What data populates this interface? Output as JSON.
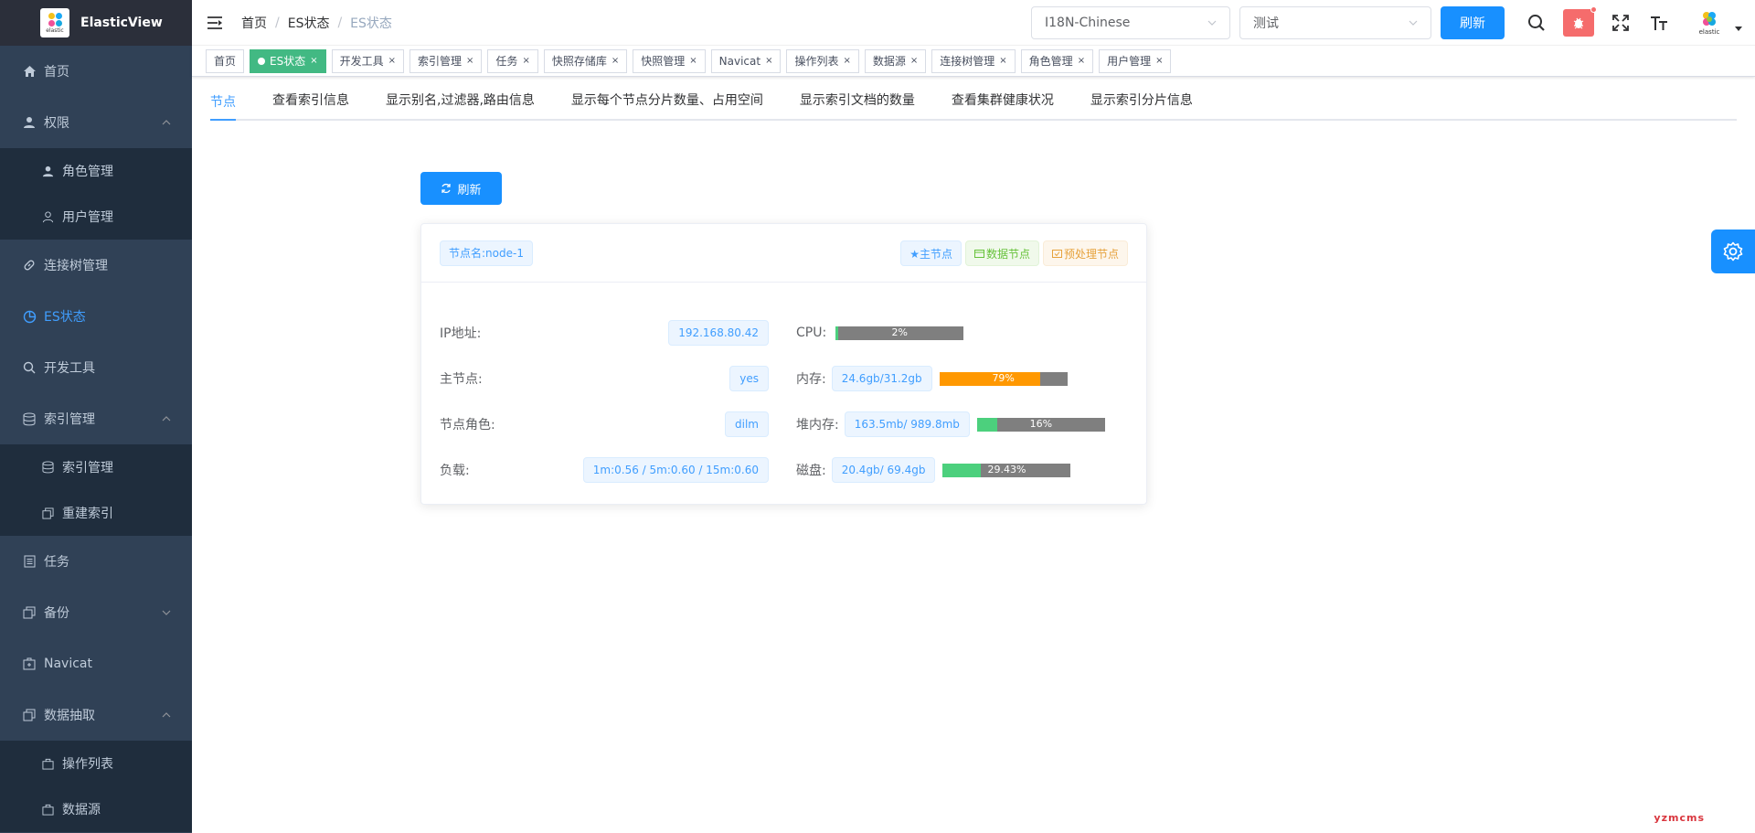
{
  "app": {
    "title": "ElasticView",
    "logo_text": "elastic"
  },
  "sidebar": {
    "items": [
      {
        "label": "首页",
        "icon": "home-icon"
      },
      {
        "label": "权限",
        "icon": "user-icon",
        "expanded": true,
        "children": [
          {
            "label": "角色管理",
            "icon": "user-icon"
          },
          {
            "label": "用户管理",
            "icon": "user-outline-icon"
          }
        ]
      },
      {
        "label": "连接树管理",
        "icon": "link-icon"
      },
      {
        "label": "ES状态",
        "icon": "pie-chart-icon",
        "active": true
      },
      {
        "label": "开发工具",
        "icon": "search-icon"
      },
      {
        "label": "索引管理",
        "icon": "database-icon",
        "expanded": true,
        "children": [
          {
            "label": "索引管理",
            "icon": "database-icon"
          },
          {
            "label": "重建索引",
            "icon": "copy-icon"
          }
        ]
      },
      {
        "label": "任务",
        "icon": "list-icon"
      },
      {
        "label": "备份",
        "icon": "copy-icon",
        "expanded": false
      },
      {
        "label": "Navicat",
        "icon": "navicat-icon"
      },
      {
        "label": "数据抽取",
        "icon": "copy-icon",
        "expanded": true,
        "children": [
          {
            "label": "操作列表",
            "icon": "bag-icon"
          },
          {
            "label": "数据源",
            "icon": "bag-icon"
          }
        ]
      }
    ]
  },
  "navbar": {
    "breadcrumb": [
      "首页",
      "ES状态",
      "ES状态"
    ],
    "language_select": "I18N-Chinese",
    "cluster_select": "测试",
    "refresh_label": "刷新"
  },
  "tags": [
    {
      "label": "首页",
      "closable": false,
      "active": false
    },
    {
      "label": "ES状态",
      "closable": true,
      "active": true
    },
    {
      "label": "开发工具",
      "closable": true
    },
    {
      "label": "索引管理",
      "closable": true
    },
    {
      "label": "任务",
      "closable": true
    },
    {
      "label": "快照存储库",
      "closable": true
    },
    {
      "label": "快照管理",
      "closable": true
    },
    {
      "label": "Navicat",
      "closable": true
    },
    {
      "label": "操作列表",
      "closable": true
    },
    {
      "label": "数据源",
      "closable": true
    },
    {
      "label": "连接树管理",
      "closable": true
    },
    {
      "label": "角色管理",
      "closable": true
    },
    {
      "label": "用户管理",
      "closable": true
    }
  ],
  "tabs": [
    "节点",
    "查看索引信息",
    "显示别名,过滤器,路由信息",
    "显示每个节点分片数量、占用空间",
    "显示索引文档的数量",
    "查看集群健康状况",
    "显示索引分片信息"
  ],
  "refresh_button": "刷新",
  "node": {
    "name_badge": "节点名:node-1",
    "roles": [
      "★主节点",
      "数据节点",
      "预处理节点"
    ],
    "ip_label": "IP地址:",
    "ip": "192.168.80.42",
    "master_label": "主节点:",
    "master": "yes",
    "role_label": "节点角色:",
    "role": "dilm",
    "load_label": "负载:",
    "load": "1m:0.56 / 5m:0.60 / 15m:0.60",
    "cpu_label": "CPU:",
    "cpu_pct": 2,
    "cpu_text": "2%",
    "mem_label": "内存:",
    "mem": "24.6gb/31.2gb",
    "mem_pct": 79,
    "mem_text": "79%",
    "heap_label": "堆内存:",
    "heap": "163.5mb/ 989.8mb",
    "heap_pct": 16,
    "heap_text": "16%",
    "disk_label": "磁盘:",
    "disk": "20.4gb/ 69.4gb",
    "disk_pct": 29.43,
    "disk_text": "29.43%"
  },
  "colors": {
    "accent": "#1890ff",
    "sidebar_bg": "#304156",
    "green": "#42b983",
    "orange": "#ff9800",
    "bar_green": "#4cd07d"
  },
  "watermark": "yzmcms"
}
